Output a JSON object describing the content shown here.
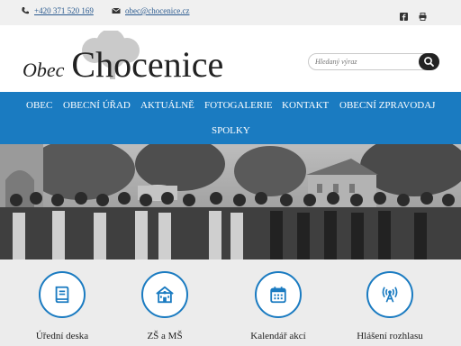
{
  "topbar": {
    "phone": "+420 371 520 169",
    "email": "obec@chocenice.cz",
    "icons": [
      "facebook-icon",
      "print-icon"
    ]
  },
  "header": {
    "logo_small": "Obec",
    "logo_big": "Chocenice",
    "search_placeholder": "Hledaný výraz",
    "search_icon": "search-icon"
  },
  "nav": {
    "items": [
      "OBEC",
      "OBECNÍ ÚŘAD",
      "AKTUÁLNĚ",
      "FOTOGALERIE",
      "KONTAKT",
      "OBECNÍ ZPRAVODAJ",
      "SPOLKY"
    ]
  },
  "tiles": [
    {
      "label": "Úřední deska",
      "icon": "book-icon"
    },
    {
      "label": "ZŠ a MŠ",
      "icon": "school-icon"
    },
    {
      "label": "Kalendář akcí",
      "icon": "calendar-icon"
    },
    {
      "label": "Hlášení rozhlasu",
      "icon": "broadcast-icon"
    }
  ],
  "colors": {
    "accent": "#1a7bc1",
    "topbar_bg": "#f0f0f0",
    "tiles_bg": "#ececec"
  }
}
